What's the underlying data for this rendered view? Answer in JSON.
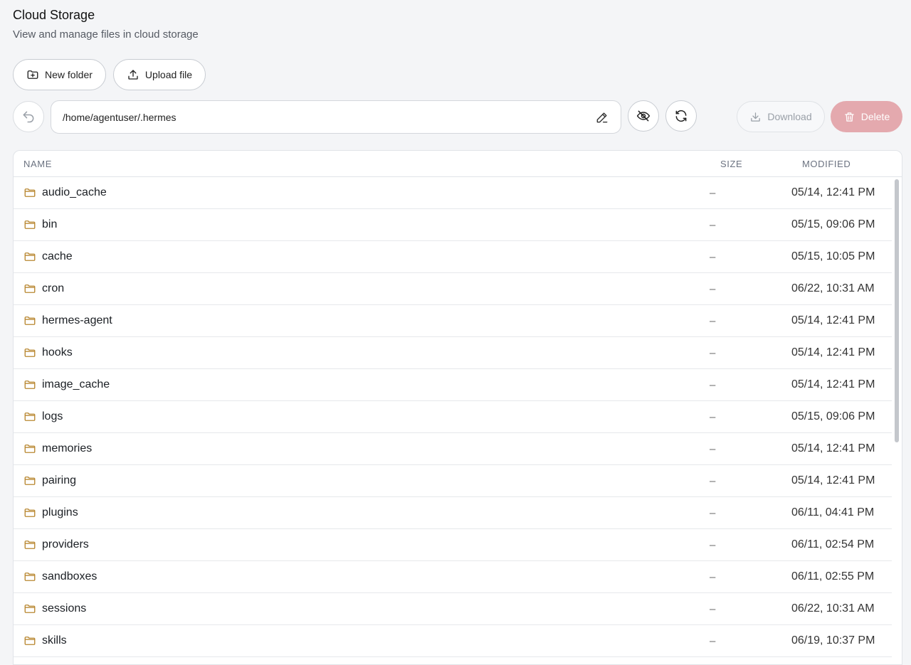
{
  "header": {
    "title": "Cloud Storage",
    "subtitle": "View and manage files in cloud storage"
  },
  "actions": {
    "new_folder": "New folder",
    "upload_file": "Upload file"
  },
  "toolbar": {
    "path": "/home/agentuser/.hermes",
    "download": "Download",
    "delete": "Delete"
  },
  "table": {
    "columns": {
      "name": "NAME",
      "size": "SIZE",
      "modified": "MODIFIED"
    },
    "rows": [
      {
        "name": "audio_cache",
        "size": "–",
        "modified": "05/14, 12:41 PM"
      },
      {
        "name": "bin",
        "size": "–",
        "modified": "05/15, 09:06 PM"
      },
      {
        "name": "cache",
        "size": "–",
        "modified": "05/15, 10:05 PM"
      },
      {
        "name": "cron",
        "size": "–",
        "modified": "06/22, 10:31 AM"
      },
      {
        "name": "hermes-agent",
        "size": "–",
        "modified": "05/14, 12:41 PM"
      },
      {
        "name": "hooks",
        "size": "–",
        "modified": "05/14, 12:41 PM"
      },
      {
        "name": "image_cache",
        "size": "–",
        "modified": "05/14, 12:41 PM"
      },
      {
        "name": "logs",
        "size": "–",
        "modified": "05/15, 09:06 PM"
      },
      {
        "name": "memories",
        "size": "–",
        "modified": "05/14, 12:41 PM"
      },
      {
        "name": "pairing",
        "size": "–",
        "modified": "05/14, 12:41 PM"
      },
      {
        "name": "plugins",
        "size": "–",
        "modified": "06/11, 04:41 PM"
      },
      {
        "name": "providers",
        "size": "–",
        "modified": "06/11, 02:54 PM"
      },
      {
        "name": "sandboxes",
        "size": "–",
        "modified": "06/11, 02:55 PM"
      },
      {
        "name": "sessions",
        "size": "–",
        "modified": "06/22, 10:31 AM"
      },
      {
        "name": "skills",
        "size": "–",
        "modified": "06/19, 10:37 PM"
      }
    ]
  },
  "colors": {
    "folder": "#b8862f",
    "delete_bg": "#e4a9ae",
    "page_bg": "#f4f5f7"
  },
  "icons": {
    "folder": "folder-icon",
    "back": "undo-arrow-icon",
    "edit": "pencil-icon",
    "hidden": "eye-off-icon",
    "refresh": "refresh-icon",
    "download": "download-icon",
    "delete": "trash-icon"
  }
}
